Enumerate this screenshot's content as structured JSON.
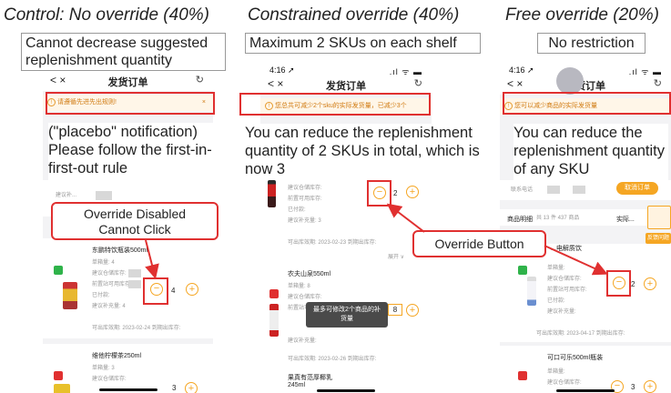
{
  "headings": {
    "control": "Control: No override (40%)",
    "constrained": "Constrained override (40%)",
    "free": "Free override (20%)"
  },
  "captions": {
    "control": "Cannot decrease suggested replenishment quantity",
    "constrained": "Maximum 2 SKUs on each shelf",
    "free": "No restriction"
  },
  "phone": {
    "time": "4:16 ➚",
    "signal": ".ıl ᯤ ▬",
    "back": "< ×",
    "title": "发货订单",
    "refresh": "↻"
  },
  "notices": {
    "control": "请遵循先进先出规则!",
    "constrained": "您总共可减少2个sku的实际发货量，已减少3个",
    "free": "您可以减少商品的实际发货量",
    "close": "×",
    "warn": "!"
  },
  "overlays": {
    "control": "(\"placebo\" notification) Please follow the first-in-first-out rule",
    "constrained": "You can reduce the replenishment quantity of 2 SKUs in total, which is now 3",
    "free": "You can reduce the replenishment quantity of any SKU"
  },
  "callouts": {
    "override_disabled": "Override Disabled\nCannot Click",
    "override_button": "Override Button"
  },
  "control_phone": {
    "partial_label": "建议补...",
    "product1": {
      "name": "东鹏特饮瓶装500ml",
      "lines": [
        "单箱量: 4",
        "建议仓储库存: ",
        "前置站可用库存: ",
        "已付款: ",
        "建议补充量: 4"
      ],
      "expiry": "可出库效期: 2023-02-24 到期出库存:",
      "qty": "4"
    },
    "product2": {
      "name": "维他柠檬茶250ml",
      "lines": [
        "单箱量: 3",
        "建议仓储库存: "
      ],
      "qty": "3"
    }
  },
  "constrained_phone": {
    "product0": {
      "lines": [
        "建议仓储库存: ",
        "前置可用库存: ",
        "已付款: ",
        "建议补充量: 3"
      ],
      "expiry": "可出库效期: 2023-02-23 到期出库存:",
      "qty": "2",
      "more": "展开 ∨"
    },
    "product1": {
      "name": "农夫山泉550ml",
      "lines": [
        "单箱量: 8",
        "建议仓储库存: ",
        "前置站可用库存: "
      ],
      "qty": "8",
      "tail": "建议补充量:"
    },
    "tooltip": "最多可修改2个商品的补货量",
    "expiry2": "可出库效期: 2023-02-26 到期出库存:",
    "product2": {
      "name": "果真有范厚椰乳",
      "sub": "245ml"
    }
  },
  "free_phone": {
    "contact": "联系电话",
    "cancel": "取消订单",
    "detail": "商品明细",
    "detail_count": "共 13 件 437 商品",
    "actual": "实际...",
    "feedback": "反馈问题",
    "product1": {
      "name": "...电解质饮",
      "lines": [
        "单箱量: ",
        "建议仓储库存: ",
        "前置站可用库存: ",
        "已付款: ",
        "建议补充量: "
      ],
      "expiry": "可出库效期: 2023-04-17 到期出库存:",
      "qty": "2"
    },
    "product2": {
      "name": "可口可乐500ml瓶装",
      "lines": [
        "单箱量: ",
        "建议仓储库存: "
      ],
      "qty": "3"
    }
  }
}
